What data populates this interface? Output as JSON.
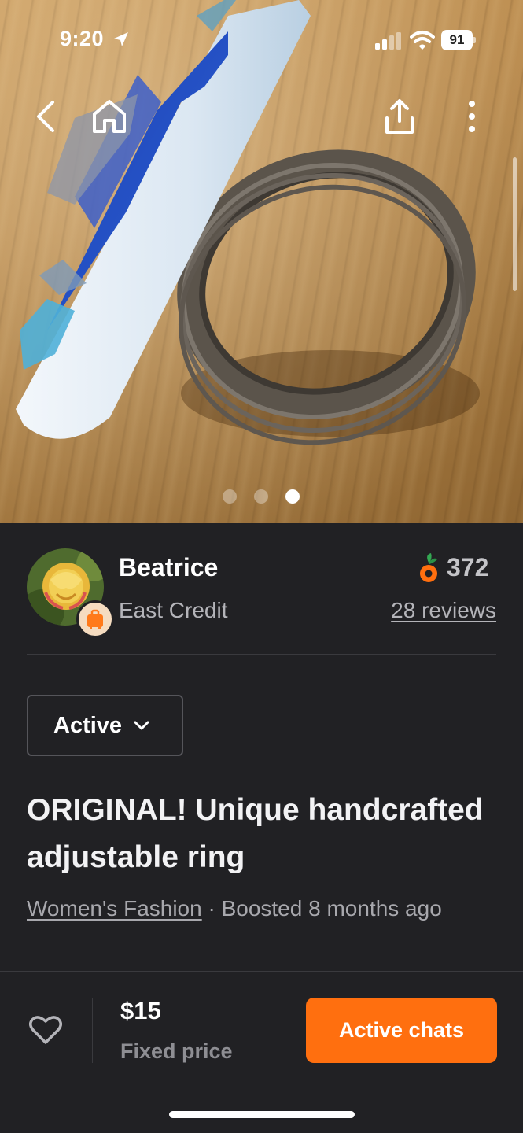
{
  "status_bar": {
    "time": "9:20",
    "battery": "91",
    "icons": [
      "location-arrow-icon",
      "cellular-signal-icon",
      "wifi-icon",
      "battery-icon"
    ]
  },
  "photo": {
    "nav_icons": [
      "back-chevron-icon",
      "home-icon",
      "share-upload-icon",
      "more-vertical-icon"
    ],
    "slides_total": 3,
    "active_slide": 3
  },
  "seller": {
    "name": "Beatrice",
    "location": "East Credit",
    "score": "372",
    "reviews": "28 reviews",
    "badge_icon": "suitcase-icon",
    "score_icon": "carrot-icon"
  },
  "listing": {
    "status": "Active",
    "title": "ORIGINAL! Unique handcrafted adjustable ring",
    "category": "Women's Fashion",
    "meta": " · Boosted 8 months ago"
  },
  "bottom_bar": {
    "price": "$15",
    "price_type": "Fixed price",
    "cta": "Active chats",
    "heart_icon": "heart-outline-icon"
  },
  "colors": {
    "background": "#212124",
    "accent": "#ff6f0f",
    "muted_text": "#b4b4b9"
  }
}
